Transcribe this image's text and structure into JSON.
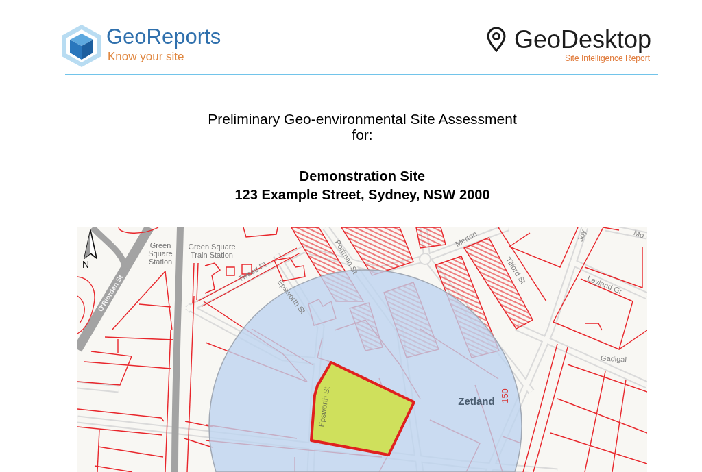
{
  "header": {
    "left_logo": {
      "name": "GeoReports",
      "tagline": "Know your site"
    },
    "right_logo": {
      "name": "GeoDesktop",
      "tagline": "Site Intelligence Report"
    }
  },
  "title": {
    "lines": [
      "Preliminary Geo-environmental Site Assessment",
      "for:"
    ]
  },
  "site": {
    "name": "Demonstration Site",
    "address": "123 Example Street, Sydney, NSW 2000"
  },
  "map": {
    "north_label": "N",
    "labels": [
      {
        "kind": "station",
        "text": "Green Square Station"
      },
      {
        "kind": "station",
        "text": "Green Square Train Station"
      },
      {
        "kind": "road",
        "text": "O'Riordan St"
      },
      {
        "kind": "street",
        "text": "Tweed Pl"
      },
      {
        "kind": "street",
        "text": "Epsworth St"
      },
      {
        "kind": "street",
        "text": "Portman St"
      },
      {
        "kind": "street",
        "text": "Merton"
      },
      {
        "kind": "street",
        "text": "Tilford St"
      },
      {
        "kind": "street",
        "text": "Leyland Gr"
      },
      {
        "kind": "street",
        "text": "Gadigal"
      },
      {
        "kind": "suburb",
        "text": "Zetland"
      },
      {
        "kind": "distance",
        "text": "150"
      },
      {
        "kind": "street",
        "text": "Joy"
      },
      {
        "kind": "street",
        "text": "Mo"
      },
      {
        "kind": "site_street",
        "text": "Epsworth St"
      }
    ]
  }
}
